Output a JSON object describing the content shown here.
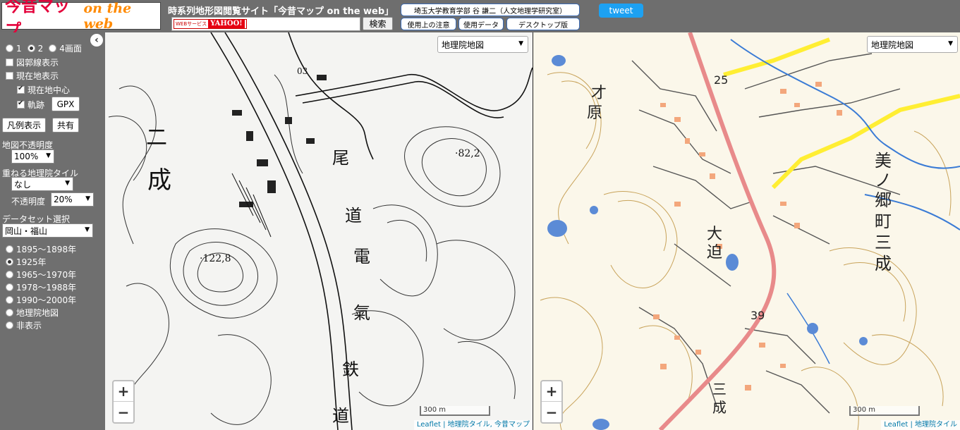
{
  "header": {
    "logo_main": "今昔マップ",
    "logo_sub": "on the web",
    "site_title": "時系列地形図閲覧サイト「今昔マップ on the web」",
    "yahoo_badge_ws": "WEBサービス",
    "yahoo_badge_brand": "YAHOO!",
    "search_value": "",
    "search_button": "検索",
    "author_link": "埼玉大学教育学部 谷 謙二（人文地理学研究室）",
    "notice_button": "使用上の注意",
    "data_button": "使用データ",
    "desktop_button": "デスクトップ版",
    "tweet_button": "tweet"
  },
  "sidebar": {
    "collapse_icon": "chevron-left-icon",
    "collapse_glyph": "‹",
    "screen_options": [
      "1",
      "2",
      "4画面"
    ],
    "screen_selected": 1,
    "grid_label": "図郭線表示",
    "location_label": "現在地表示",
    "center_label": "現在地中心",
    "track_label": "軌跡",
    "gpx_button": "GPX",
    "legend_button": "凡例表示",
    "share_button": "共有",
    "opacity_label": "地図不透明度",
    "opacity_value": "100%",
    "overlay_label": "重ねる地理院タイル",
    "overlay_value": "なし",
    "overlay_opacity_label": "不透明度",
    "overlay_opacity_value": "20%",
    "dataset_label": "データセット選択",
    "dataset_value": "岡山・福山",
    "periods": [
      "1895～1898年",
      "1925年",
      "1965～1970年",
      "1978～1988年",
      "1990～2000年",
      "地理院地図",
      "非表示"
    ],
    "period_selected": 1
  },
  "map_left": {
    "layer": "地理院地図",
    "zoom_in": "+",
    "zoom_out": "−",
    "scale": "300 m",
    "attribution": "Leaflet | 地理院タイル, 今昔マップ",
    "labels": {
      "a": "二",
      "b": "成",
      "c": "尾",
      "d": "道",
      "e": "電",
      "f": "氣",
      "g": "鉄",
      "h": "道",
      "i": "·82,2",
      "j": "·122,8",
      "k": "03"
    }
  },
  "map_right": {
    "layer": "地理院地図",
    "zoom_in": "+",
    "zoom_out": "−",
    "scale": "300 m",
    "attribution": "Leaflet | 地理院タイル",
    "labels": {
      "a": "才",
      "b": "原",
      "c": "大",
      "d": "迫",
      "e": "美",
      "f": "ノ",
      "g": "郷",
      "h": "町",
      "i": "三",
      "j": "成",
      "k": "三",
      "l": "成",
      "m": "25",
      "n": "39"
    }
  }
}
